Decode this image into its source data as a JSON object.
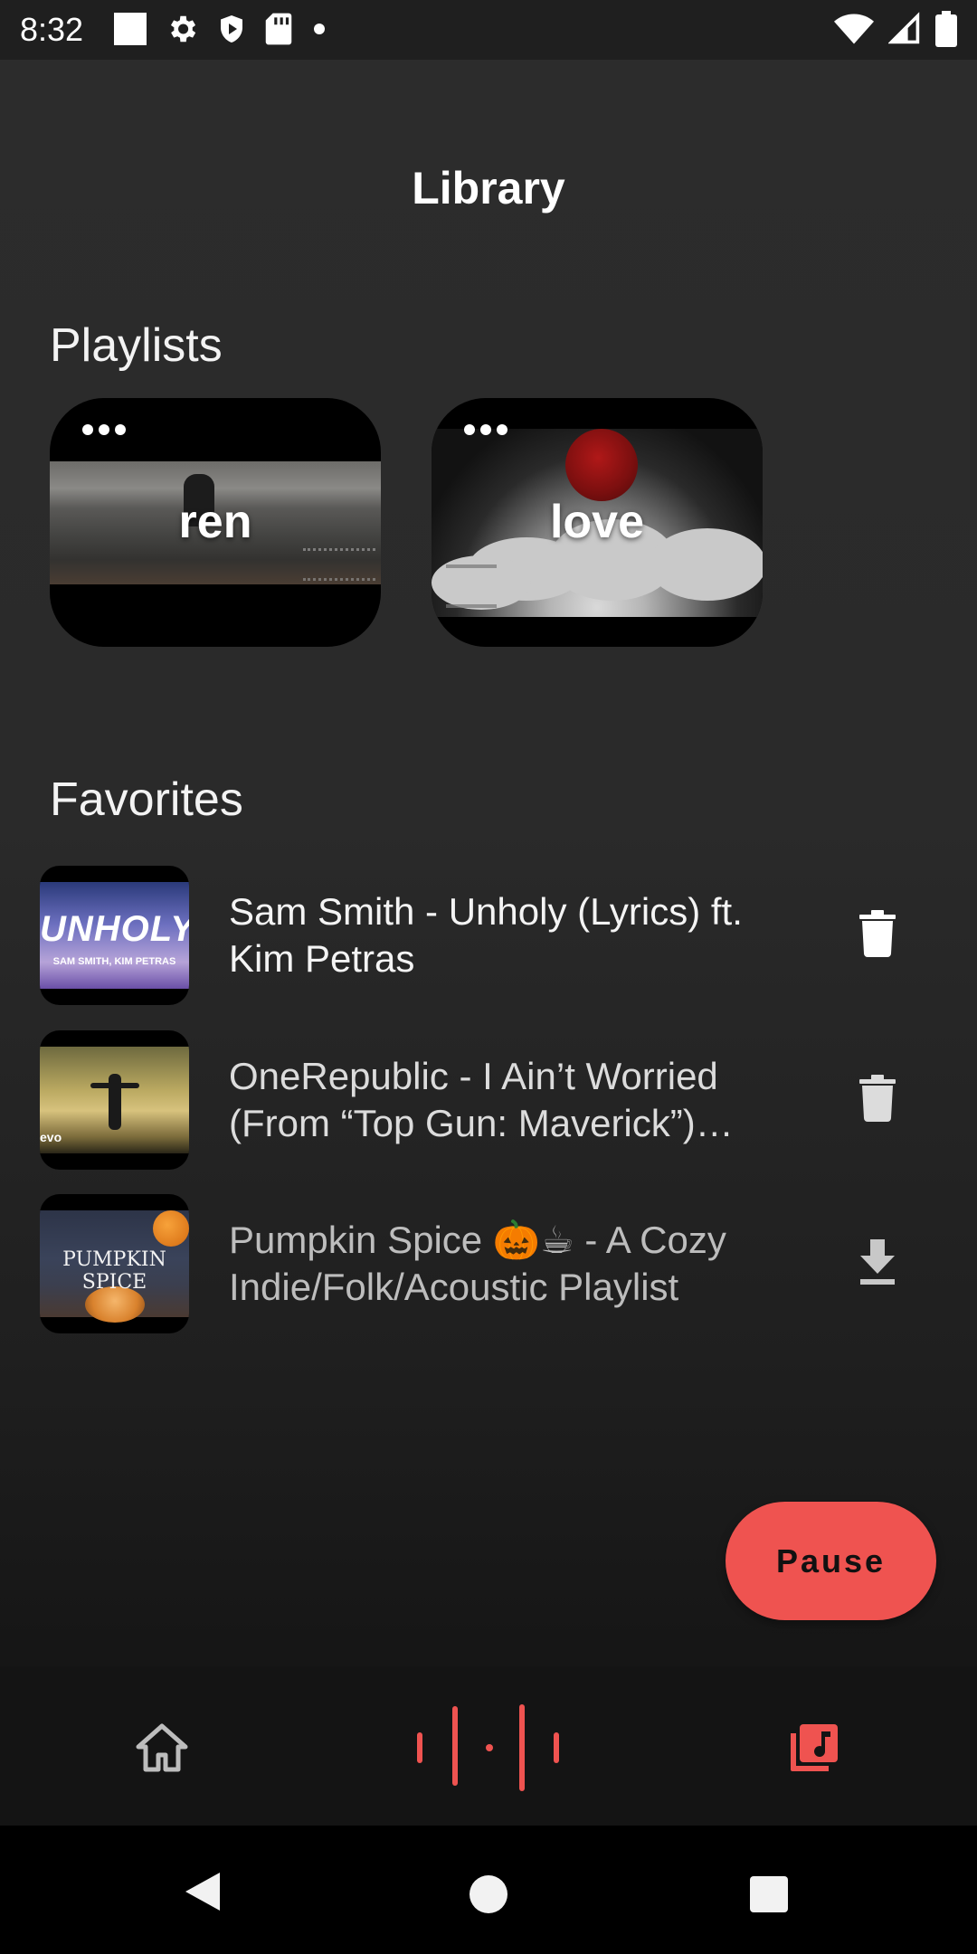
{
  "status_bar": {
    "time": "8:32",
    "left_icons": [
      "notification-square-icon",
      "gear-icon",
      "shield-play-icon",
      "sd-card-icon",
      "dot-icon"
    ],
    "right_icons": [
      "wifi-icon",
      "cellular-signal-icon",
      "battery-icon"
    ]
  },
  "header": {
    "title": "Library"
  },
  "playlists": {
    "section_title": "Playlists",
    "items": [
      {
        "name": "ren",
        "menu_icon": "more-horizontal-icon"
      },
      {
        "name": "love",
        "menu_icon": "more-horizontal-icon"
      }
    ]
  },
  "favorites": {
    "section_title": "Favorites",
    "items": [
      {
        "title": "Sam Smith - Unholy (Lyrics) ft. Kim Petras",
        "thumb_text": "UNHOLY",
        "thumb_subtext": "SAM SMITH, KIM PETRAS",
        "action_icon": "trash-icon"
      },
      {
        "title": "OneRepublic - I Ain’t Worried (From “Top Gun: Maverick”) [Official Music Video]",
        "thumb_text": "evo",
        "action_icon": "trash-icon"
      },
      {
        "title": "Pumpkin Spice 🎃☕ - A Cozy Indie/Folk/Acoustic Playlist",
        "thumb_text": "PUMPKIN SPICE",
        "action_icon": "download-icon"
      }
    ]
  },
  "player": {
    "pause_label": "Pause"
  },
  "bottom_nav": {
    "items": [
      {
        "name": "home",
        "icon": "home-icon",
        "active": false
      },
      {
        "name": "now-playing",
        "icon": "audio-wave-icon",
        "active": false
      },
      {
        "name": "library",
        "icon": "library-music-icon",
        "active": true
      }
    ]
  },
  "colors": {
    "accent": "#ef5350",
    "background": "#2a2a2a",
    "nav_background": "#141414",
    "text_primary": "#ffffff"
  }
}
